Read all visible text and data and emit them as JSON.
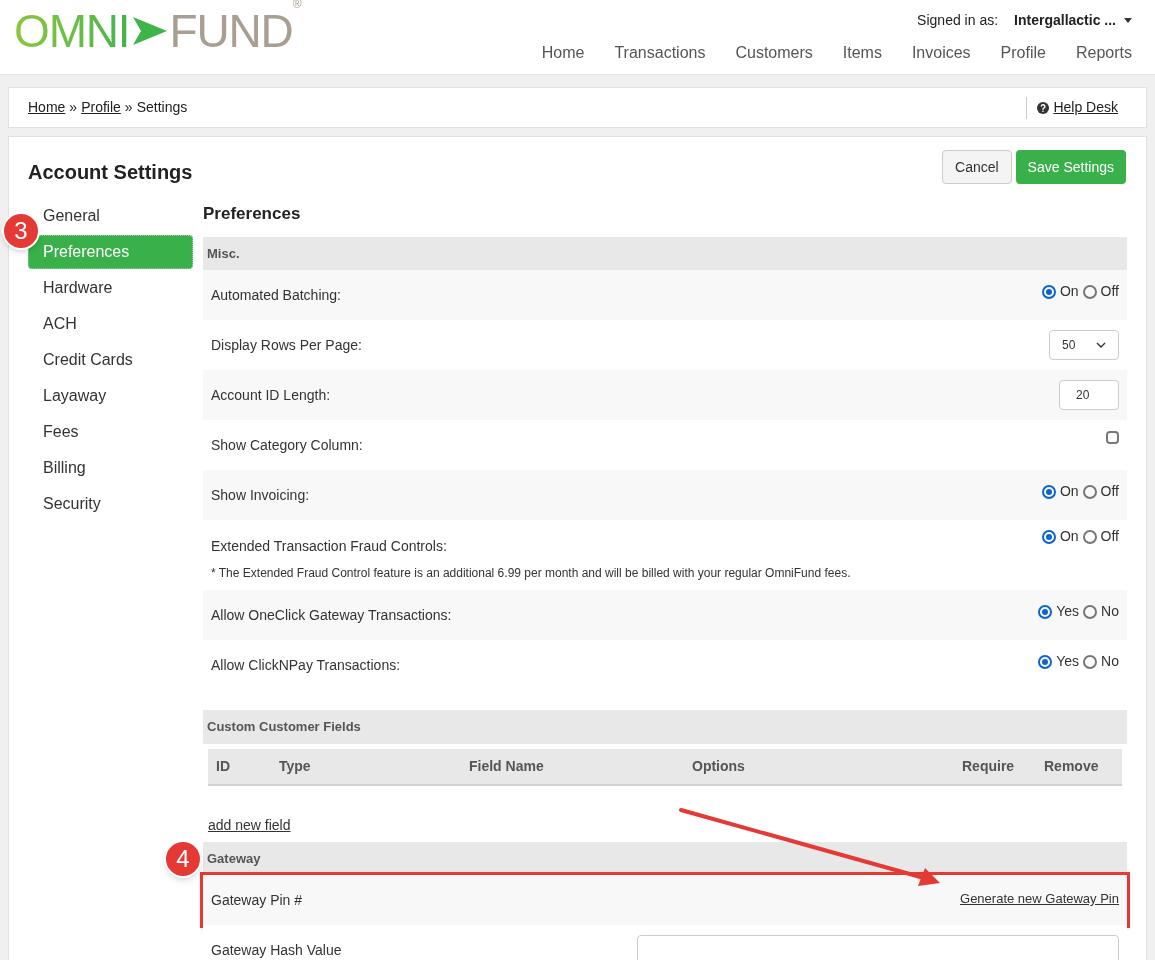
{
  "logo": {
    "left": "OMNI",
    "right": "FUND",
    "mark": "®"
  },
  "user": {
    "label": "Signed in as:",
    "name": "Intergallactic ..."
  },
  "nav": [
    {
      "label": "Home"
    },
    {
      "label": "Transactions"
    },
    {
      "label": "Customers"
    },
    {
      "label": "Items"
    },
    {
      "label": "Invoices"
    },
    {
      "label": "Profile"
    },
    {
      "label": "Reports"
    }
  ],
  "breadcrumb": {
    "links": [
      "Home",
      "Profile"
    ],
    "separator": "»",
    "current": "Settings"
  },
  "help": "Help Desk",
  "title": "Account Settings",
  "buttons": {
    "cancel": "Cancel",
    "save": "Save Settings"
  },
  "sidebar": [
    {
      "label": "General",
      "selected": false
    },
    {
      "label": "Preferences",
      "selected": true
    },
    {
      "label": "Hardware",
      "selected": false
    },
    {
      "label": "ACH",
      "selected": false
    },
    {
      "label": "Credit Cards",
      "selected": false
    },
    {
      "label": "Layaway",
      "selected": false
    },
    {
      "label": "Fees",
      "selected": false
    },
    {
      "label": "Billing",
      "selected": false
    },
    {
      "label": "Security",
      "selected": false
    }
  ],
  "section_title": "Preferences",
  "misc": {
    "heading": "Misc.",
    "rows": [
      {
        "kind": "radio",
        "label": "Automated Batching:",
        "options": [
          {
            "label": "On",
            "selected": true
          },
          {
            "label": "Off",
            "selected": false
          }
        ]
      },
      {
        "kind": "select",
        "label": "Display Rows Per Page:",
        "value": "50"
      },
      {
        "kind": "input",
        "label": "Account ID Length:",
        "value": "20"
      },
      {
        "kind": "checkbox",
        "label": "Show Category Column:",
        "checked": false
      },
      {
        "kind": "radio",
        "label": "Show Invoicing:",
        "options": [
          {
            "label": "On",
            "selected": true
          },
          {
            "label": "Off",
            "selected": false
          }
        ]
      },
      {
        "kind": "radio",
        "label": "Extended Transaction Fraud Controls:",
        "note": "* The Extended Fraud Control feature is an additional 6.99 per month and will be billed with your regular OmniFund fees.",
        "options": [
          {
            "label": "On",
            "selected": true
          },
          {
            "label": "Off",
            "selected": false
          }
        ]
      },
      {
        "kind": "radio",
        "label": "Allow OneClick Gateway Transactions:",
        "options": [
          {
            "label": "Yes",
            "selected": true
          },
          {
            "label": "No",
            "selected": false
          }
        ]
      },
      {
        "kind": "radio",
        "label": "Allow ClickNPay Transactions:",
        "options": [
          {
            "label": "Yes",
            "selected": true
          },
          {
            "label": "No",
            "selected": false
          }
        ]
      }
    ]
  },
  "custom_fields": {
    "heading": "Custom Customer Fields",
    "columns": [
      "ID",
      "Type",
      "Field Name",
      "Options",
      "Require",
      "Remove"
    ],
    "add_link": "add new field"
  },
  "gateway": {
    "heading": "Gateway",
    "rows": [
      {
        "kind": "link",
        "label": "Gateway Pin #",
        "link": "Generate new Gateway Pin",
        "highlighted": true
      },
      {
        "kind": "input",
        "label": "Gateway Hash Value",
        "value": "",
        "highlighted": false
      }
    ]
  },
  "annotations": [
    {
      "number": "3"
    },
    {
      "number": "4"
    }
  ]
}
